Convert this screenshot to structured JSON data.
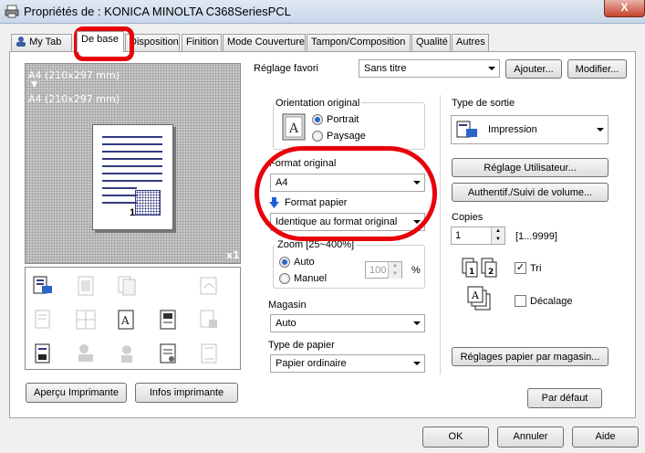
{
  "window": {
    "title": "Propriétés de : KONICA MINOLTA C368SeriesPCL",
    "close_label": "X"
  },
  "tabs": [
    {
      "label": "My Tab"
    },
    {
      "label": "De base"
    },
    {
      "label": "Disposition"
    },
    {
      "label": "Finition"
    },
    {
      "label": "Mode Couverture"
    },
    {
      "label": "Tampon/Composition"
    },
    {
      "label": "Qualité"
    },
    {
      "label": "Autres"
    }
  ],
  "preview": {
    "line1": "A4 (210x297 mm)",
    "arrow": "▼",
    "line2": "A4 (210x297 mm)",
    "page_number": "1",
    "copies_indicator": "x1"
  },
  "left_buttons": {
    "preview": "Aperçu Imprimante",
    "info": "Infos imprimante"
  },
  "favorite": {
    "label": "Réglage favori",
    "value": "Sans titre",
    "add": "Ajouter...",
    "edit": "Modifier..."
  },
  "orientation": {
    "label": "Orientation original",
    "portrait": "Portrait",
    "landscape": "Paysage",
    "selected": "Portrait"
  },
  "original_format": {
    "label": "Format original",
    "value": "A4"
  },
  "paper_format": {
    "label": "Format papier",
    "value": "Identique au format original"
  },
  "zoom": {
    "label": "Zoom [25~400%]",
    "auto": "Auto",
    "manual": "Manuel",
    "value": "100",
    "unit": "%",
    "selected": "Auto"
  },
  "tray": {
    "label": "Magasin",
    "value": "Auto"
  },
  "paper_type": {
    "label": "Type de papier",
    "value": "Papier ordinaire"
  },
  "output": {
    "label": "Type de sortie",
    "value": "Impression"
  },
  "user_settings": "Réglage Utilisateur...",
  "auth": "Authentif./Suivi de volume...",
  "copies": {
    "label": "Copies",
    "value": "1",
    "range": "[1...9999]"
  },
  "collate": {
    "label": "Tri",
    "checked": true
  },
  "offset": {
    "label": "Décalage",
    "checked": false
  },
  "paper_by_tray": "Réglages papier par magasin...",
  "default_btn": "Par défaut",
  "dialog": {
    "ok": "OK",
    "cancel": "Annuler",
    "help": "Aide"
  },
  "colors": {
    "accent": "#2a66c8",
    "annotation": "#e8000b"
  }
}
